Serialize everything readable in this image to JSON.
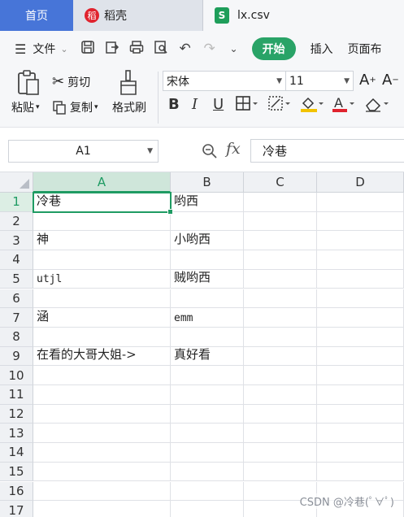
{
  "tabs": {
    "home": "首页",
    "docer": "稻壳",
    "docer_icon": "docer-logo",
    "file": "lx.csv",
    "file_icon": "S"
  },
  "menu": {
    "file": "文件",
    "start": "开始",
    "insert": "插入",
    "page": "页面布"
  },
  "ribbon": {
    "paste": "粘贴",
    "cut": "剪切",
    "copy": "复制",
    "format_painter": "格式刷",
    "font_name": "宋体",
    "font_size": "11"
  },
  "formula_bar": {
    "name_box": "A1",
    "fx": "fx",
    "content": "冷巷"
  },
  "sheet": {
    "columns": [
      "A",
      "B",
      "C",
      "D"
    ],
    "active_column": "A",
    "active_row": "1",
    "rows": [
      {
        "n": "1",
        "a": "冷巷",
        "b": "哟西"
      },
      {
        "n": "2",
        "a": "",
        "b": ""
      },
      {
        "n": "3",
        "a": "神",
        "b": "小哟西"
      },
      {
        "n": "4",
        "a": "",
        "b": ""
      },
      {
        "n": "5",
        "a": "utjl",
        "b": "贼哟西"
      },
      {
        "n": "6",
        "a": "",
        "b": ""
      },
      {
        "n": "7",
        "a": "涵",
        "b": "emm"
      },
      {
        "n": "8",
        "a": "",
        "b": ""
      },
      {
        "n": "9",
        "a": "在看的大哥大姐->",
        "b": "真好看"
      },
      {
        "n": "10",
        "a": "",
        "b": ""
      },
      {
        "n": "11",
        "a": "",
        "b": ""
      },
      {
        "n": "12",
        "a": "",
        "b": ""
      },
      {
        "n": "13",
        "a": "",
        "b": ""
      },
      {
        "n": "14",
        "a": "",
        "b": ""
      },
      {
        "n": "15",
        "a": "",
        "b": ""
      },
      {
        "n": "16",
        "a": "",
        "b": ""
      },
      {
        "n": "17",
        "a": "",
        "b": ""
      }
    ]
  },
  "watermark": "CSDN @冷巷(ﾟ∀ﾟ)",
  "colors": {
    "accent": "#1f9b63",
    "home_tab": "#4775d8",
    "start_button": "#29a367"
  }
}
